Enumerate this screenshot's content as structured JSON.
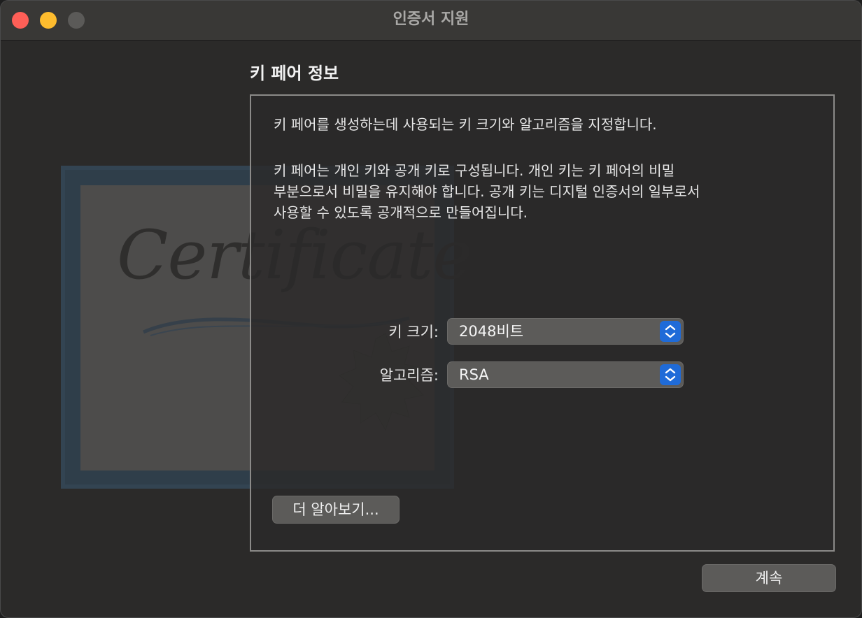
{
  "window": {
    "title": "인증서 지원"
  },
  "illustration": {
    "script_text": "Certificate",
    "frame_color": "#2f3e4a"
  },
  "section": {
    "title": "키 페어 정보",
    "description_1": "키 페어를 생성하는데 사용되는 키 크기와 알고리즘을 지정합니다.",
    "description_2": "키 페어는 개인 키와 공개 키로 구성됩니다. 개인 키는 키 페어의 비밀\n부분으로서 비밀을 유지해야 합니다. 공개 키는 디지털 인증서의 일부로서\n사용할 수 있도록 공개적으로 만들어집니다."
  },
  "form": {
    "key_size": {
      "label": "키 크기:",
      "value": "2048비트"
    },
    "algorithm": {
      "label": "알고리즘:",
      "value": "RSA"
    }
  },
  "buttons": {
    "learn_more": "더 알아보기...",
    "continue": "계속"
  },
  "colors": {
    "accent": "#1f6bd8",
    "close": "#fe5f57",
    "minimize": "#febc2e",
    "maximize": "#5b5a58"
  }
}
